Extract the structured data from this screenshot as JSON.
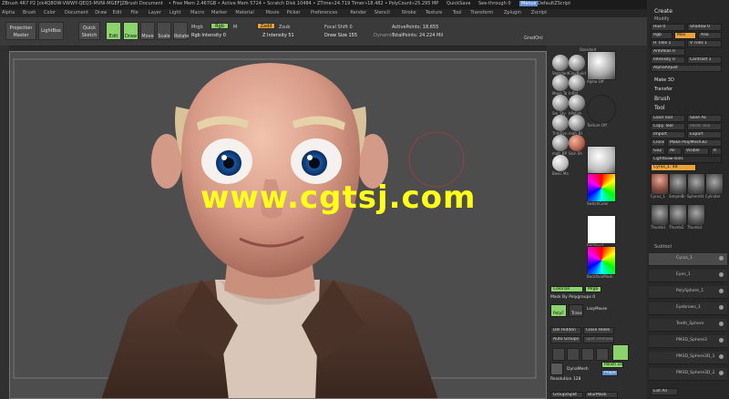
{
  "titlebar": {
    "title": "ZBrush 4R7 P2 [ck4Q8OW-VWWY-QEQ3-MVNI-MGEF]ZBrush Document",
    "free_mem": "• Free Mem 2.467GB • Active Mem 5724 • Scratch Disk 10484 • ZTime»24.719 Timer»18.482 • PolyCount»25.295 MP",
    "quicksave": "QuickSave",
    "seethrough": "See-through 0",
    "menus": "Menus",
    "defaultzscript": "DefaultZScript"
  },
  "menubar": [
    "Alpha",
    "Brush",
    "Color",
    "Document",
    "Draw",
    "Edit",
    "File",
    "Layer",
    "Light",
    "Macro",
    "Marker",
    "Material",
    "Movie",
    "Picker",
    "Preferences",
    "Render",
    "Stencil",
    "Stroke",
    "Texture",
    "Tool",
    "Transform",
    "Zplugin",
    "Zscript"
  ],
  "toolbar": {
    "projection_master": "Projection Master",
    "lightbox": "LightBox",
    "quick_sketch": "Quick Sketch",
    "edit": "Edit",
    "draw": "Draw",
    "move": "Move",
    "scale": "Scale",
    "rotate": "Rotate",
    "mrgb": "Mrgb",
    "rgb": "Rgb",
    "m": "M",
    "rgb_intensity": "Rgb Intensity 0",
    "zadd": "Zadd",
    "zsub": "Zsub",
    "z_intensity": "Z Intensity 51",
    "focal_shift": "Focal Shift 0",
    "draw_size": "Draw Size 155",
    "dynamic": "Dynamic",
    "active_points": "ActivePoints: 18,655",
    "total_points": "TotalPoints: 24.224 Mil",
    "gradoni": "GradOni"
  },
  "watermark": "www.cgtsj.com",
  "palette": {
    "header": "Standard",
    "items": [
      {
        "label": "Standard"
      },
      {
        "label": "ClayBuild"
      },
      {
        "label": "Move Ta"
      },
      {
        "label": "Inflat"
      },
      {
        "label": "Sm_Sty"
      },
      {
        "label": "hPolish"
      },
      {
        "label": "TrimDyn"
      },
      {
        "label": "mah_Bl"
      },
      {
        "label": "mah_BP"
      },
      {
        "label": "Skin Sh"
      },
      {
        "label": "Basic Ma"
      }
    ],
    "large_items": [
      {
        "label": "Alpha Off"
      },
      {
        "label": "Texture Off"
      },
      {
        "label": "Gradient"
      },
      {
        "label": "SwitchColor"
      },
      {
        "label": "FillObject"
      },
      {
        "label": "BackfaceMask"
      }
    ],
    "colorize": "Colorize",
    "mrgb_toggle": "Mrgb",
    "mask_polygroups": "Mask By Polygroups 0",
    "polyf": "PolyF",
    "transp": "Transp",
    "lazymouse": "LazyMouse",
    "del_hidden": "Del Hidden",
    "close_holes": "Close Holes",
    "auto_groups": "Auto Groups",
    "split_unmasked": "Split Unmasked",
    "dynamesh": "DynaMesh",
    "polish": "Polish 10",
    "project": "Project",
    "resolution": "Resolution 128",
    "groups_split": "GroupsSplit",
    "blur_mask": "BlurMask"
  },
  "rightpanel": {
    "create": "Create",
    "modify": "Modify",
    "hue": "Hue 0",
    "shadow": "Shadow 0",
    "rgb": "Rgb",
    "max": "Max",
    "aaa": "Aaa",
    "tiles_h": "H Tiles 1",
    "tiles_v": "V Tiles 1",
    "antialias": "AntiAlias 0",
    "intensity": "Intensity 0",
    "contrast": "Contrast 1",
    "alpha_adjust": "AlphaAdjust",
    "make3d": "Make 3D",
    "transfer": "Transfer",
    "brush": "Brush",
    "tool": "Tool",
    "load_tool": "Load Tool",
    "save_as": "Save As",
    "copy_tool": "Copy Tool",
    "paste_tool": "Paste Tool",
    "import": "Import",
    "export": "Export",
    "clone": "Clone",
    "make_polymesh": "Make PolyMesh3D",
    "goz": "GoZ",
    "all": "All",
    "visible": "Visible",
    "r": "R",
    "lightbox_tools": "Lightbox▸Tools",
    "current_tool": "Cyrus_1. 48",
    "thumbs": [
      "Cyrus_1",
      "SimpleBr",
      "SphereSt",
      "Cylinder",
      "Thumb1",
      "Thumb2",
      "Thumb3"
    ],
    "subtool": "Subtool",
    "subtools": [
      "Cyrus_1",
      "Eyes_1",
      "PolySphere_1",
      "Eyebrows_1",
      "Teeth_Sphere",
      "PM3D_Sphere3",
      "PM3D_Sphere3D_1",
      "PM3D_Sphere3D_2"
    ],
    "list_all": "List All"
  }
}
